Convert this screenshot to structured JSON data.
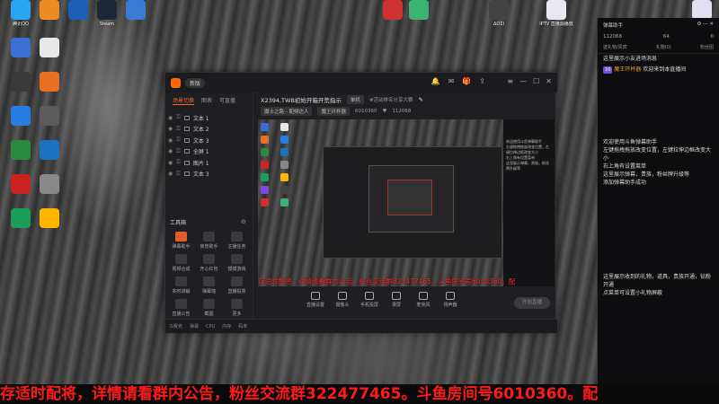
{
  "desktop": {
    "icons": [
      {
        "label": "腾讯QQ",
        "color": "#2aa4f4",
        "icon": "qq-icon"
      },
      {
        "label": "",
        "color": "#f08a24",
        "icon": "app-icon"
      },
      {
        "label": "",
        "color": "#1a5fb4",
        "icon": "app-icon"
      },
      {
        "label": "Steam",
        "color": "#1b2838",
        "icon": "steam-icon"
      },
      {
        "label": "",
        "color": "#3a7bd5",
        "icon": "app-icon"
      },
      {
        "label": "",
        "color": "#d03030",
        "icon": "netease-music-icon"
      },
      {
        "label": "",
        "color": "#3cb371",
        "icon": "app-icon"
      },
      {
        "label": "ΔΟΣΙ",
        "color": "#444",
        "icon": "game-icon"
      },
      {
        "label": "IPTV 直播源播放",
        "color": "#e8e8f0",
        "icon": "file-icon"
      },
      {
        "label": "",
        "color": "#e0e0f0",
        "icon": "file-icon"
      }
    ]
  },
  "app": {
    "version_badge": "新版",
    "room_title": "X2394,TWB初始开箱开荒指示",
    "room_category": "单机",
    "room_tag": "#活动排名分享大赛",
    "meta_pill1": "魔士之路 - 配频达人",
    "meta_pill2": "魔王环杯器",
    "room_id": "6010360",
    "fans": "112068",
    "scene_tabs": [
      "场景切换",
      "图表",
      "可直播"
    ],
    "sources": [
      {
        "label": "文本 1"
      },
      {
        "label": "文本 2"
      },
      {
        "label": "文本 3"
      },
      {
        "label": "全屏 1"
      },
      {
        "label": "图片 1"
      },
      {
        "label": "文本 3"
      }
    ],
    "tools_title": "工具箱",
    "tools": [
      {
        "label": "弹幕助手",
        "highlight": true
      },
      {
        "label": "房管助手",
        "highlight": false
      },
      {
        "label": "主播任务",
        "highlight": false
      },
      {
        "label": "视频合成",
        "highlight": false
      },
      {
        "label": "开心红包",
        "highlight": false
      },
      {
        "label": "摸摸游戏",
        "highlight": false
      },
      {
        "label": "实时讲解",
        "highlight": false
      },
      {
        "label": "弹幕墙",
        "highlight": false
      },
      {
        "label": "直播投票",
        "highlight": false
      },
      {
        "label": "直播公告",
        "highlight": false
      },
      {
        "label": "截图",
        "highlight": false
      },
      {
        "label": "更多",
        "highlight": false
      }
    ],
    "controls": [
      {
        "label": "直播设置"
      },
      {
        "label": "摄像头"
      },
      {
        "label": "手机投屏"
      },
      {
        "label": "录屏"
      },
      {
        "label": "麦克风"
      },
      {
        "label": "扬声器"
      }
    ],
    "go_live": "开始直播",
    "status": [
      "马赛克",
      "弹幕",
      "CPU",
      "内存",
      "码率"
    ],
    "preview_marquee": "存适时配将，详情请看群内公告，粉丝交流群322477465。斗鱼房间号6010360。配"
  },
  "helper": {
    "title": "弹幕助手",
    "stats": [
      "112068",
      "64",
      "0"
    ],
    "tabs": [
      "送礼物/贵宾",
      "礼物(0)",
      "粉丝团"
    ],
    "line1": "这里展示小友进场消息",
    "level": "10",
    "user": "魔王环杯器",
    "welcome": "欢迎来到本直播间",
    "intro": [
      "欢迎使用斗鱼弹幕助手",
      "左键拖拽拖放改变位置，左键拉伸边框改变大小",
      "右上角有设置菜单",
      "这里展示弹幕，贵族，粉丝牌升级等",
      "添加弹幕助手成功"
    ],
    "bottom": [
      "这里展示收到的礼物，道具，贵族开通，钻粉开通",
      "点菜单可设置小礼物屏蔽"
    ]
  },
  "marquee": {
    "text": "存适时配将，详情请看群内公告，粉丝交流群322477465。斗鱼房间号6010360。配"
  }
}
